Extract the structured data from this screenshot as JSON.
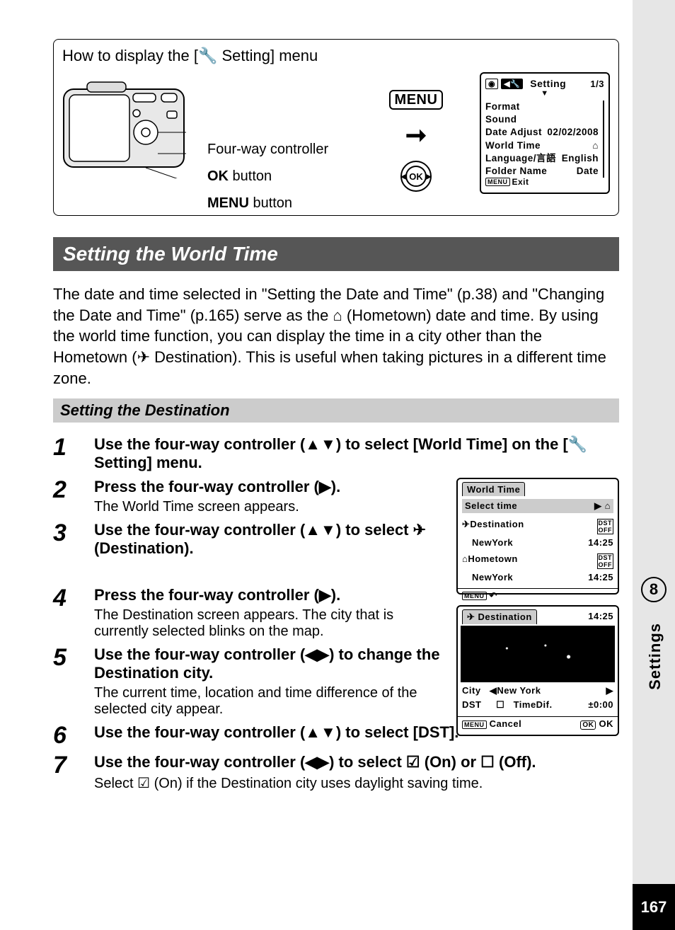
{
  "howto": {
    "title_pre": "How to display the [",
    "title_post": " Setting] menu",
    "four_way": "Four-way controller",
    "ok_bold": "OK",
    "ok_rest": " button",
    "menu_bold": "MENU",
    "menu_rest": " button",
    "menu_pill": "MENU",
    "ok_inner": "OK"
  },
  "lcd_setting": {
    "title": "Setting",
    "page": "1/3",
    "rows": [
      {
        "l": "Format",
        "r": ""
      },
      {
        "l": "Sound",
        "r": ""
      },
      {
        "l": "Date Adjust",
        "r": "02/02/2008"
      },
      {
        "l": "World Time",
        "r": "⌂"
      },
      {
        "l": "Language/言語",
        "r": "English"
      },
      {
        "l": "Folder Name",
        "r": "Date"
      }
    ],
    "exit": "Exit",
    "menu": "MENU"
  },
  "h2": "Setting the World Time",
  "para": "The date and time selected in \"Setting the Date and Time\" (p.38) and \"Changing the Date and Time\" (p.165) serve as the ⌂ (Hometown) date and time. By using the world time function, you can display the time in a city other than the Hometown (✈ Destination). This is useful when taking pictures in a different time zone.",
  "subhead": "Setting the Destination",
  "steps": [
    {
      "n": "1",
      "bold": "Use the four-way controller (▲▼) to select [World Time] on the [🔧 Setting] menu.",
      "desc": ""
    },
    {
      "n": "2",
      "bold": "Press the four-way controller (▶).",
      "desc": "The World Time screen appears."
    },
    {
      "n": "3",
      "bold": "Use the four-way controller (▲▼) to select ✈ (Destination).",
      "desc": ""
    },
    {
      "n": "4",
      "bold": "Press the four-way controller (▶).",
      "desc": "The Destination screen appears. The city that is currently selected blinks on the map."
    },
    {
      "n": "5",
      "bold": "Use the four-way controller (◀▶) to change the Destination city.",
      "desc": "The current time, location and time difference of the selected city appear."
    },
    {
      "n": "6",
      "bold": "Use the four-way controller (▲▼) to select [DST].",
      "desc": ""
    },
    {
      "n": "7",
      "bold": "Use the four-way controller (◀▶) to select ☑ (On) or ☐ (Off).",
      "desc": "Select ☑ (On) if the Destination city uses daylight saving time."
    }
  ],
  "wt_lcd": {
    "tab": "World Time",
    "select": "Select time",
    "select_r": "▶ ⌂",
    "dest": "✈Destination",
    "dest_dst": "DST OFF",
    "dest_city": "NewYork",
    "dest_time": "14:25",
    "home": "⌂Hometown",
    "home_dst": "DST OFF",
    "home_city": "NewYork",
    "home_time": "14:25",
    "menu": "MENU",
    "back": "↶"
  },
  "dest_lcd": {
    "tab": "✈ Destination",
    "tab_time": "14:25",
    "city_l": "City",
    "city_v": "◀New York",
    "city_r": "▶",
    "dst_l": "DST",
    "dst_box": "☐",
    "timedif": "TimeDif.",
    "timedif_v": "±0:00",
    "menu": "MENU",
    "cancel": "Cancel",
    "ok": "OK",
    "ok2": "OK"
  },
  "side": {
    "chapter": "8",
    "label": "Settings",
    "page": "167"
  }
}
